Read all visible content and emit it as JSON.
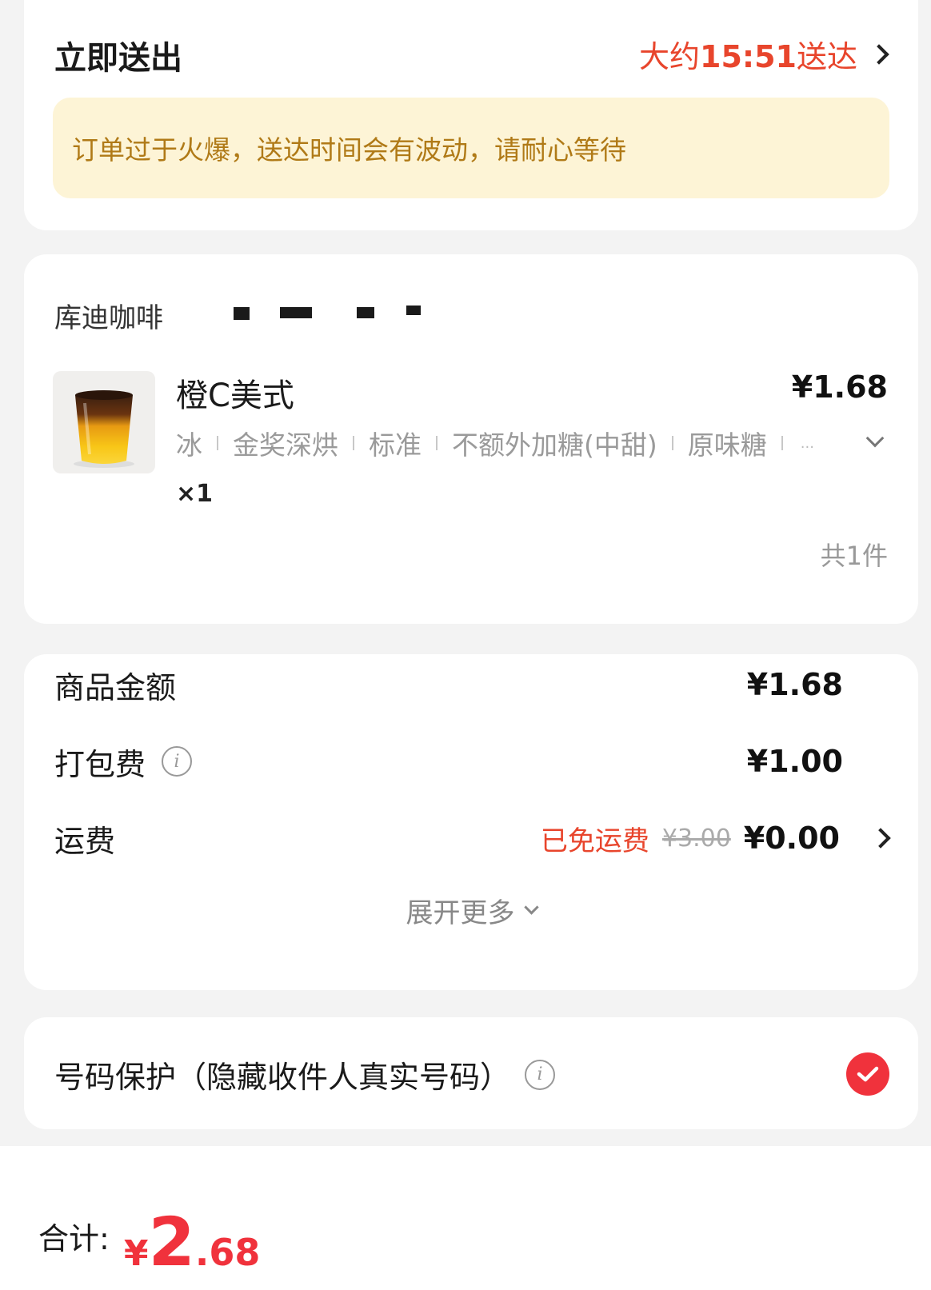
{
  "delivery": {
    "title": "立即送出",
    "eta_prefix": "大约",
    "eta_time": "15:51",
    "eta_suffix": "送达",
    "notice": "订单过于火爆，送达时间会有波动，请耐心等待"
  },
  "shop": {
    "name": "库迪咖啡"
  },
  "item": {
    "name": "橙C美式",
    "price": "¥1.68",
    "specs": [
      "冰",
      "金奖深烘",
      "标准",
      "不额外加糖(中甜)",
      "原味糖"
    ],
    "specs_more": "...",
    "qty": "×1",
    "count": "共1件"
  },
  "price_details": {
    "goods_label": "商品金额",
    "goods_value": "¥1.68",
    "packing_label": "打包费",
    "packing_value": "¥1.00",
    "shipping_label": "运费",
    "shipping_free": "已免运费",
    "shipping_original": "¥3.00",
    "shipping_value": "¥0.00",
    "expand": "展开更多"
  },
  "privacy": {
    "label": "号码保护（隐藏收件人真实号码）",
    "checked": true
  },
  "total": {
    "label": "合计:",
    "symbol": "¥",
    "integer": "2",
    "decimal": ".68"
  },
  "colors": {
    "accent_red": "#f0323c",
    "eta_red": "#e8452c",
    "notice_bg": "#fdf4d6",
    "notice_text": "#b07a17"
  }
}
